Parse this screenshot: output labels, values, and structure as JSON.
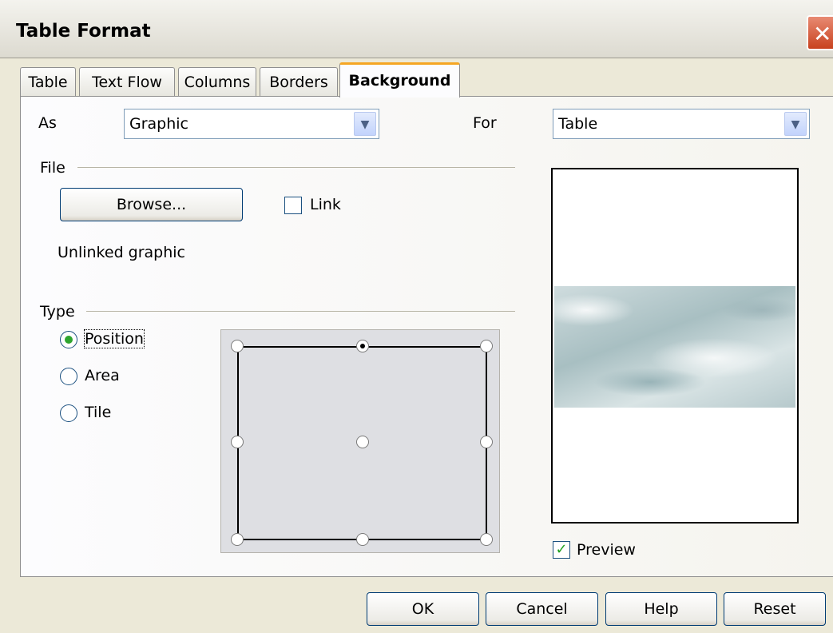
{
  "window": {
    "title": "Table Format",
    "close_glyph": "✕"
  },
  "tabs": [
    {
      "label": "Table"
    },
    {
      "label": "Text Flow"
    },
    {
      "label": "Columns"
    },
    {
      "label": "Borders"
    },
    {
      "label": "Background",
      "active": true
    }
  ],
  "background": {
    "as_label": "As",
    "as_value": "Graphic",
    "for_label": "For",
    "for_value": "Table",
    "file_group": "File",
    "browse_label": "Browse...",
    "link_label": "Link",
    "link_checked": false,
    "unlinked_text": "Unlinked graphic",
    "type_group": "Type",
    "type_options": [
      {
        "label": "Position",
        "selected": true
      },
      {
        "label": "Area",
        "selected": false
      },
      {
        "label": "Tile",
        "selected": false
      }
    ],
    "selected_position": "top-center",
    "preview_label": "Preview",
    "preview_checked": true
  },
  "buttons": {
    "ok": "OK",
    "cancel": "Cancel",
    "help": "Help",
    "reset": "Reset"
  },
  "icons": {
    "dropdown": "chevron-down-icon",
    "close": "close-icon",
    "check": "checkmark-icon"
  }
}
